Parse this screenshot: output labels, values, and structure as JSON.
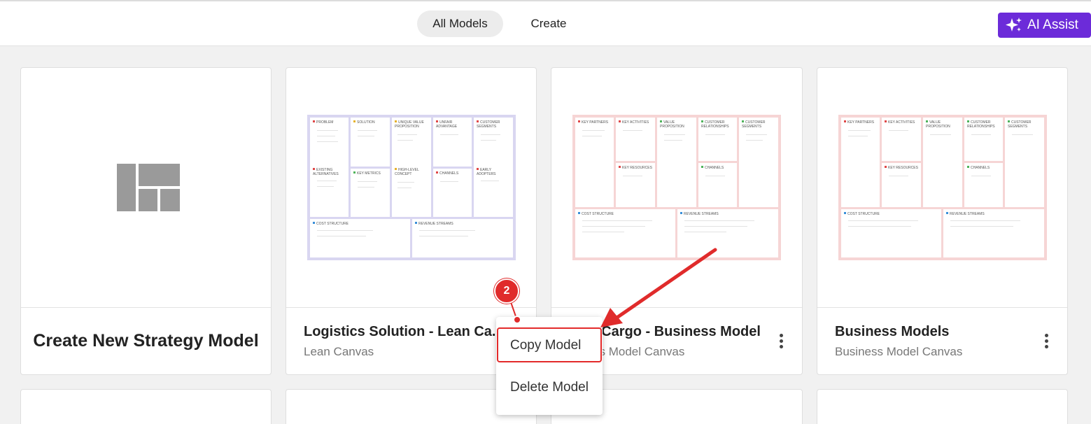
{
  "header": {
    "tabs": [
      {
        "label": "All Models",
        "active": true
      },
      {
        "label": "Create",
        "active": false
      }
    ],
    "ai_button": {
      "label": "AI Assist",
      "icon": "sparkles-icon",
      "color": "#6c2bd9"
    }
  },
  "cards": [
    {
      "title": "Create New Strategy Model",
      "icon": "layout-grid-icon"
    },
    {
      "title": "Logistics Solution - Lean Ca...",
      "subtitle": "Lean Canvas"
    },
    {
      "title": "sCargo - Business Model",
      "subtitle": "ss Model Canvas"
    },
    {
      "title": "Business Models",
      "subtitle": "Business Model Canvas"
    }
  ],
  "lean_canvas": {
    "blocks": [
      "PROBLEM",
      "SOLUTION",
      "UNIQUE VALUE PROPOSITION",
      "UNFAIR ADVANTAGE",
      "CUSTOMER SEGMENTS",
      "EXISTING ALTERNATIVES",
      "KEY METRICS",
      "HIGH-LEVEL CONCEPT",
      "CHANNELS",
      "EARLY ADOPTERS",
      "COST STRUCTURE",
      "REVENUE STREAMS"
    ],
    "border_color": "#d9d6f1"
  },
  "bm_canvas": {
    "blocks": [
      "KEY PARTNERS",
      "KEY ACTIVITIES",
      "VALUE PROPOSITION",
      "CUSTOMER RELATIONSHIPS",
      "CUSTOMER SEGMENTS",
      "KEY RESOURCES",
      "CHANNELS",
      "COST STRUCTURE",
      "REVENUE STREAMS"
    ],
    "border_color": "#f6d5d5"
  },
  "context_menu": {
    "items": [
      "Copy Model",
      "Delete Model"
    ]
  },
  "annotation": {
    "step": "2",
    "color": "#e02b2b"
  }
}
